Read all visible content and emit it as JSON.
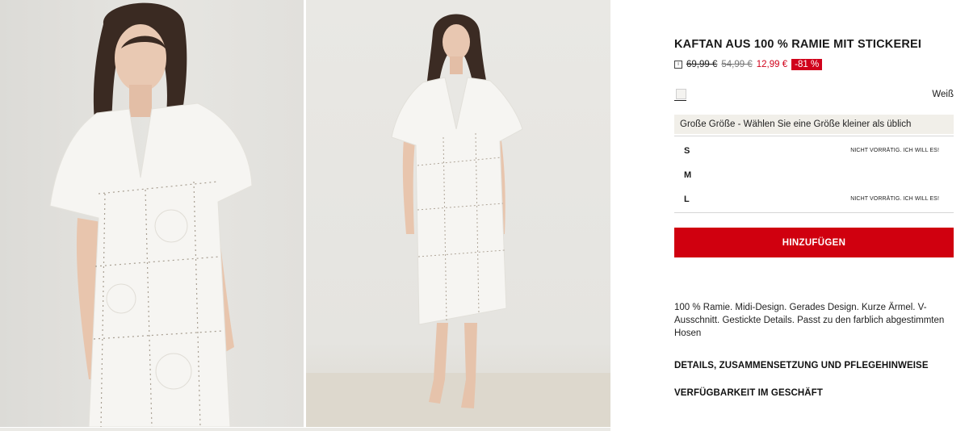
{
  "gallery": {
    "images": [
      {
        "name": "product-photo-front-closeup"
      },
      {
        "name": "product-photo-full-length"
      }
    ]
  },
  "product": {
    "title": "KAFTAN AUS 100 % RAMIE MIT STICKEREI",
    "price_original": "69,99 €",
    "price_previous": "54,99 €",
    "price_current": "12,99 €",
    "discount": "-81 %",
    "info_icon": "i",
    "color": {
      "name": "Weiß",
      "swatch_hex": "#f4f3f0"
    },
    "size_hint": "Große Größe - Wählen Sie eine Größe kleiner als üblich",
    "sizes": [
      {
        "label": "S",
        "status": "NICHT VORRÄTIG. ICH WILL ES!"
      },
      {
        "label": "M",
        "status": ""
      },
      {
        "label": "L",
        "status": "NICHT VORRÄTIG. ICH WILL ES!"
      }
    ],
    "add_button": "HINZUFÜGEN",
    "description": "100 % Ramie. Midi-Design. Gerades Design. Kurze Ärmel. V-Ausschnitt. Gestickte Details. Passt zu den farblich abgestimmten Hosen",
    "details_link": "DETAILS, ZUSAMMENSETZUNG UND PFLEGEHINWEISE",
    "stores_link": "VERFÜGBARKEIT IM GESCHÄFT"
  },
  "colors": {
    "accent_red": "#d0000f",
    "sale_red": "#d0021b",
    "hint_bg": "#f1efe9"
  }
}
